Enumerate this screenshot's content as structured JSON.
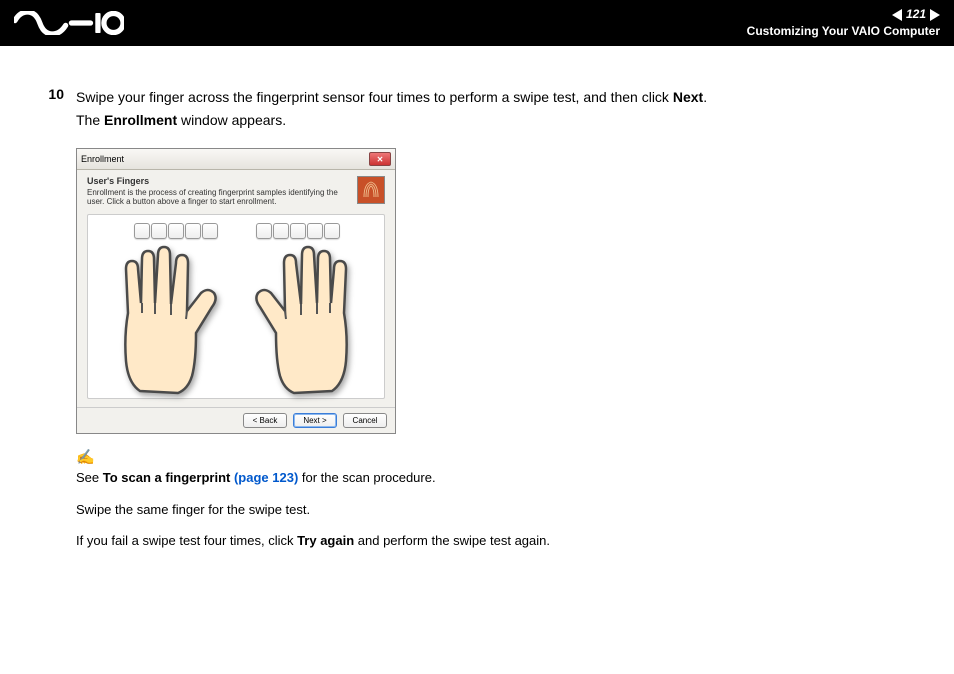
{
  "header": {
    "page_number": "121",
    "title": "Customizing Your VAIO Computer"
  },
  "step": {
    "number": "10",
    "line1_pre": "Swipe your finger across the fingerprint sensor four times to perform a swipe test, and then click ",
    "line1_bold": "Next",
    "line1_post": ".",
    "line2_pre": "The ",
    "line2_bold": "Enrollment",
    "line2_post": " window appears."
  },
  "dialog": {
    "title": "Enrollment",
    "section_heading": "User's Fingers",
    "description": "Enrollment is the process of creating fingerprint samples identifying the user. Click a button above a finger to start enrollment.",
    "buttons": {
      "back": "< Back",
      "next": "Next >",
      "cancel": "Cancel"
    }
  },
  "notes": {
    "see_pre": "See ",
    "see_bold": "To scan a fingerprint ",
    "see_link": "(page 123)",
    "see_post": " for the scan procedure.",
    "line2": "Swipe the same finger for the swipe test.",
    "line3_pre": "If you fail a swipe test four times, click ",
    "line3_bold": "Try again",
    "line3_post": " and perform the swipe test again."
  }
}
